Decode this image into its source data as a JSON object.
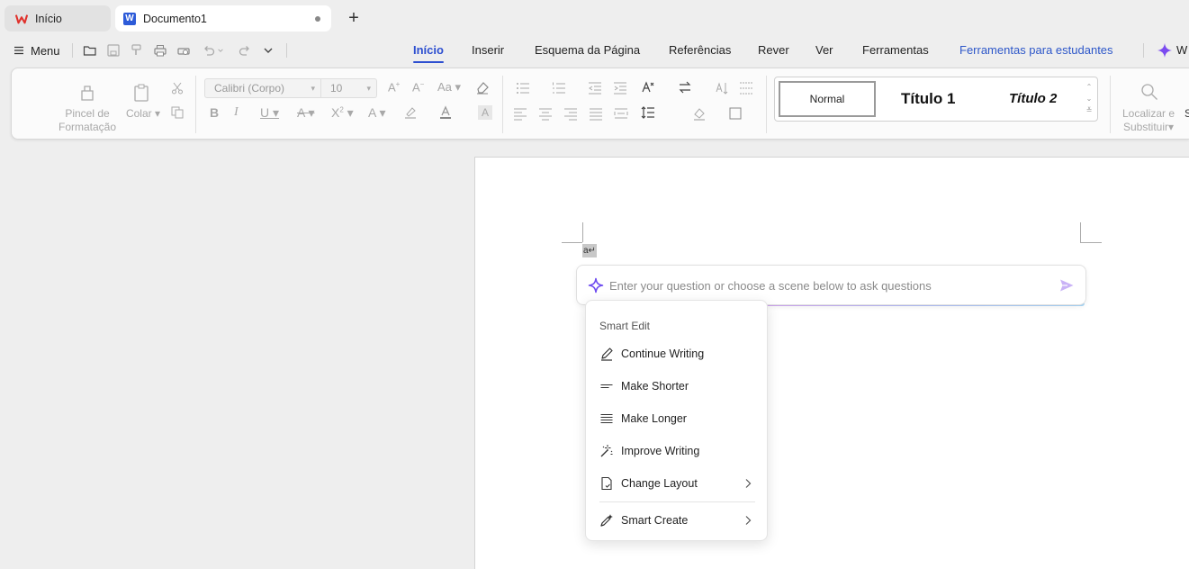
{
  "tabs": [
    {
      "label": "Início"
    },
    {
      "label": "Documento1"
    }
  ],
  "menu_label": "Menu",
  "ribbon_tabs": [
    "Início",
    "Inserir",
    "Esquema da Página",
    "Referências",
    "Rever",
    "Ver",
    "Ferramentas",
    "Ferramentas para estudantes"
  ],
  "ribbon_tab_cut": "W",
  "ribbon": {
    "painter_label_1": "Pincel de",
    "painter_label_2": "Formatação",
    "paste_label": "Colar",
    "font_name": "Calibri (Corpo)",
    "font_size": "10",
    "find_label_1": "Localizar e",
    "find_label_2": "Substituir",
    "find_cut": "S"
  },
  "styles": {
    "normal": "Normal",
    "title1": "Título 1",
    "title2": "Título 2"
  },
  "document": {
    "selected_text": "a↵"
  },
  "ai": {
    "placeholder": "Enter your question or choose a scene below to ask questions"
  },
  "smart_menu": {
    "title": "Smart Edit",
    "items": [
      {
        "label": "Continue Writing",
        "icon": "pencil-icon"
      },
      {
        "label": "Make Shorter",
        "icon": "short-lines-icon"
      },
      {
        "label": "Make Longer",
        "icon": "long-lines-icon"
      },
      {
        "label": "Improve Writing",
        "icon": "magic-wand-icon"
      },
      {
        "label": "Change Layout",
        "icon": "layout-doc-icon",
        "submenu": true
      },
      {
        "label": "Smart Create",
        "icon": "sparkle-pen-icon",
        "submenu": true
      }
    ]
  },
  "colors": {
    "accent": "#2d4fd0",
    "wps_red": "#e0312b",
    "ai_purple": "#7b4bf0"
  }
}
